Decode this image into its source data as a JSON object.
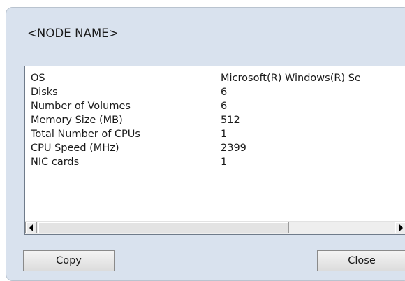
{
  "dialog": {
    "title": "<NODE NAME>"
  },
  "properties": [
    {
      "key": "OS",
      "value": "Microsoft(R) Windows(R) Se"
    },
    {
      "key": "Disks",
      "value": "6"
    },
    {
      "key": "Number of Volumes",
      "value": "6"
    },
    {
      "key": "Memory Size (MB)",
      "value": "512"
    },
    {
      "key": "Total Number of CPUs",
      "value": "1"
    },
    {
      "key": "CPU Speed (MHz)",
      "value": "2399"
    },
    {
      "key": "NIC cards",
      "value": "1"
    }
  ],
  "buttons": {
    "copy_label": "Copy",
    "close_label": "Close"
  },
  "icons": {
    "scroll_left": "arrow-left-icon",
    "scroll_right": "arrow-right-icon"
  },
  "colors": {
    "dialog_background": "#d9e2ee",
    "list_background": "#ffffff"
  }
}
